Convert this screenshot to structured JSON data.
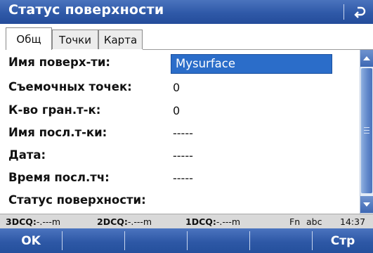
{
  "titlebar": {
    "title": "Статус поверхности",
    "back_icon": "back-arrow-icon"
  },
  "tabs": [
    {
      "label": "Общ",
      "active": true
    },
    {
      "label": "Точки",
      "active": false
    },
    {
      "label": "Карта",
      "active": false
    }
  ],
  "fields": {
    "surface_name_label": "Имя поверх-ти:",
    "surface_name_value": "Mysurface",
    "survey_points_label": "Съемочных точек:",
    "survey_points_value": "0",
    "boundary_points_label": "К-во гран.т-к:",
    "boundary_points_value": "0",
    "last_point_name_label": "Имя посл.т-ки:",
    "last_point_name_value": "-----",
    "date_label": "Дата:",
    "date_value": "-----",
    "last_point_time_label": "Время посл.тч:",
    "last_point_time_value": "-----",
    "surface_status_label": "Статус поверхности:"
  },
  "statusbar": {
    "q3d_label": "3DCQ:",
    "q3d_value": "-.---m",
    "q2d_label": "2DCQ:",
    "q2d_value": "-.---m",
    "q1d_label": "1DCQ:",
    "q1d_value": "-.---m",
    "fn": "Fn",
    "input_mode": "abc",
    "time": "14:37"
  },
  "fkeys": {
    "f1": "OK",
    "f6": "Стр"
  },
  "colors": {
    "titlebar": "#2f59a8",
    "selection": "#2b6dc9",
    "statusbar": "#d9d9d9"
  }
}
